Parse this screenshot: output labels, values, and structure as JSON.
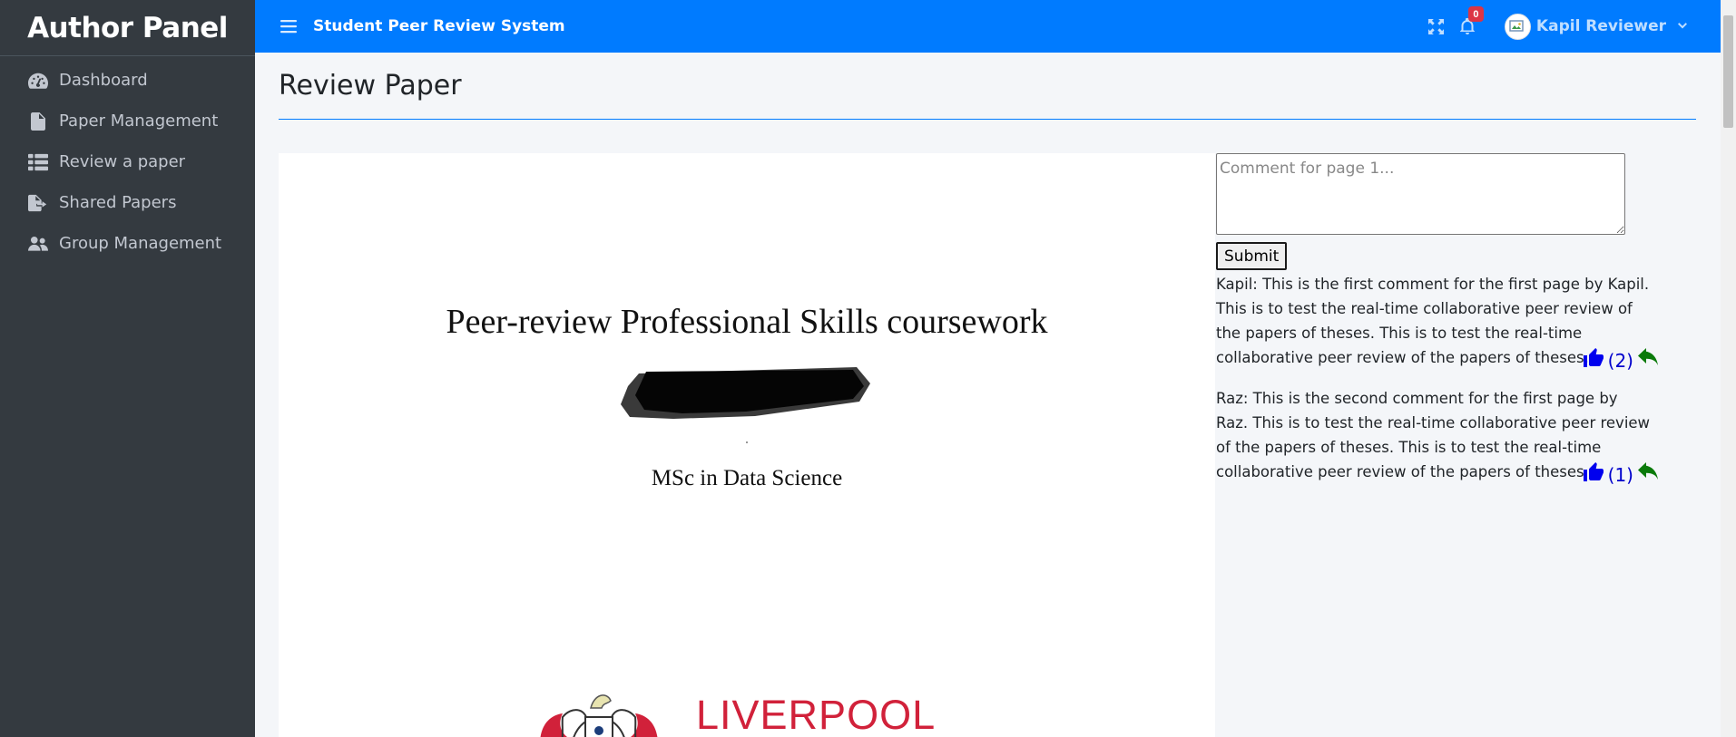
{
  "sidebar": {
    "brand": "Author Panel",
    "items": [
      {
        "label": "Dashboard",
        "icon": "dashboard-icon"
      },
      {
        "label": "Paper Management",
        "icon": "file-icon"
      },
      {
        "label": "Review a paper",
        "icon": "list-icon"
      },
      {
        "label": "Shared Papers",
        "icon": "file-export-icon"
      },
      {
        "label": "Group Management",
        "icon": "users-icon"
      }
    ]
  },
  "header": {
    "title": "Student Peer Review System",
    "notifications_count": "0",
    "user_name": "Kapil Reviewer"
  },
  "main": {
    "page_title": "Review Paper",
    "pdf": {
      "title": "Peer-review Professional Skills coursework",
      "subtitle": "MSc in Data Science",
      "university": "LIVERPOOL"
    },
    "comment_form": {
      "placeholder": "Comment for page 1...",
      "submit_label": "Submit"
    },
    "comments": [
      {
        "text": "Kapil: This is the first comment for the first page by Kapil. This is to test the real-time collaborative peer review of the papers of theses. This is to test the real-time collaborative peer review of the papers of theses.",
        "likes": "(2)"
      },
      {
        "text": "Raz: This is the second comment for the first page by Raz. This is to test the real-time collaborative peer review of the papers of theses. This is to test the real-time collaborative peer review of the papers of theses",
        "likes": "(1)"
      }
    ]
  },
  "colors": {
    "header_bg": "#007bff",
    "sidebar_bg": "#343a40",
    "badge": "#dc3545",
    "like": "#0000ee",
    "reply": "#0a7a0a",
    "university_red": "#d1213a"
  }
}
